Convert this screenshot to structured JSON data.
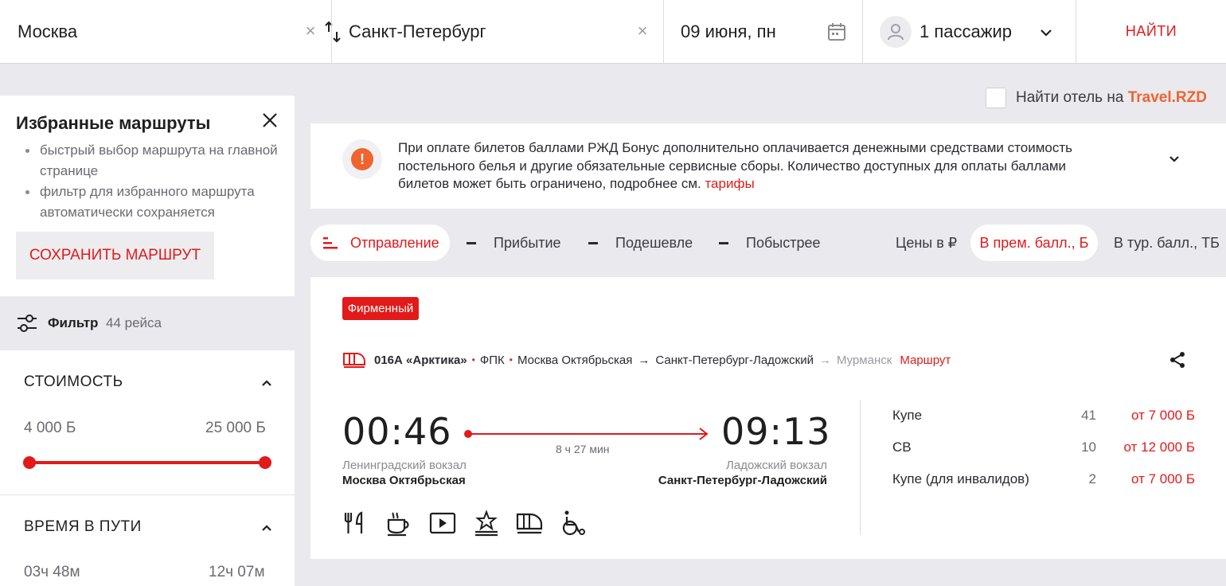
{
  "search": {
    "from": "Москва",
    "to": "Санкт-Петербург",
    "date": "09 июня, пн",
    "passengers": "1 пассажир",
    "find_label": "НАЙТИ"
  },
  "favorites": {
    "title": "Избранные маршруты",
    "bullets": [
      "быстрый выбор маршрута на главной странице",
      "фильтр для избранного маршрута автоматически сохраняется"
    ],
    "save_label": "СОХРАНИТЬ МАРШРУТ"
  },
  "filter": {
    "label": "Фильтр",
    "count": "44 рейса"
  },
  "cost": {
    "title": "СТОИМОСТЬ",
    "min": "4 000 Б",
    "max": "25 000 Б",
    "slider_low_fraction": 0.0,
    "slider_high_fraction": 1.0
  },
  "travel_time": {
    "title": "ВРЕМЯ В ПУТИ",
    "min": "03ч 48м",
    "max": "12ч 07м"
  },
  "hotel": {
    "text": "Найти отель на ",
    "link": "Travel.RZD"
  },
  "notice": {
    "text": "При оплате билетов баллами РЖД Бонус дополнительно оплачивается денежными средствами стоимость постельного белья и другие обязательные сервисные сборы. Количество доступных для оплаты баллами билетов может быть ограничено, подробнее см. ",
    "link": "тарифы"
  },
  "sort": {
    "departure": "Отправление",
    "arrival": "Прибытие",
    "cheaper": "Подешевле",
    "faster": "Побыстрее",
    "prices_in": "Цены в ₽",
    "premium_points": "В прем. балл., Б",
    "tourist_points": "В тур. балл., ТБ"
  },
  "train": {
    "badge": "Фирменный",
    "number": "016А «Арктика»",
    "carrier": "ФПК",
    "from_station": "Москва Октябрьская",
    "to_station": "Санкт-Петербург-Ладожский",
    "final_station": "Мурманск",
    "route_link": "Маршрут",
    "departure_time": "00:46",
    "arrival_time": "09:13",
    "duration": "8 ч 27 мин",
    "departure_sub": "Ленинградский вокзал",
    "departure_main": "Москва Октябрьская",
    "arrival_sub": "Ладожский вокзал",
    "arrival_main": "Санкт-Петербург-Ладожский",
    "amenities": [
      "restaurant-icon",
      "coffee-icon",
      "video-icon",
      "premium-icon",
      "fast-train-icon",
      "wheelchair-icon"
    ],
    "seats": [
      {
        "type": "Купе",
        "count": "41",
        "price": "от 7 000 Б"
      },
      {
        "type": "СВ",
        "count": "10",
        "price": "от 12 000 Б"
      },
      {
        "type": "Купе (для инвалидов)",
        "count": "2",
        "price": "от 7 000 Б"
      }
    ]
  },
  "colors": {
    "accent": "#e21a1a",
    "orange": "#f0642d",
    "background": "#e9e9ee"
  }
}
